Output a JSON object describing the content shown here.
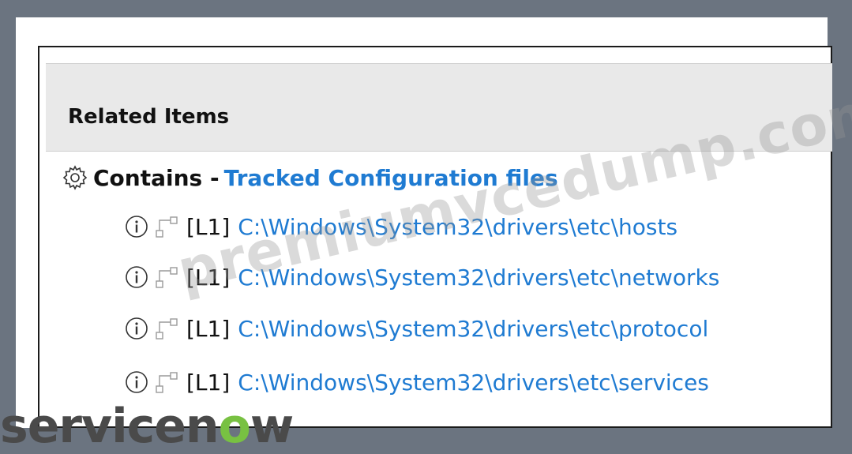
{
  "related_items": {
    "title": "Related Items",
    "relation_label": "Contains -",
    "relation_link": "Tracked Configuration files",
    "items": [
      {
        "level": "[L1]",
        "path": "C:\\Windows\\System32\\drivers\\etc\\hosts"
      },
      {
        "level": "[L1]",
        "path": "C:\\Windows\\System32\\drivers\\etc\\networks"
      },
      {
        "level": "[L1]",
        "path": "C:\\Windows\\System32\\drivers\\etc\\protocol"
      },
      {
        "level": "[L1]",
        "path": "C:\\Windows\\System32\\drivers\\etc\\services"
      }
    ]
  },
  "watermark": "premiumvcedump.com",
  "brand": {
    "prefix": "servicen",
    "o": "o",
    "suffix": "w"
  },
  "colors": {
    "link": "#1f7bd2",
    "header_bg": "#e9e9e9",
    "brand_green": "#78c142"
  },
  "icons": {
    "relation": "gear-icon",
    "item_info": "info-icon",
    "item_relation": "relationship-icon"
  }
}
